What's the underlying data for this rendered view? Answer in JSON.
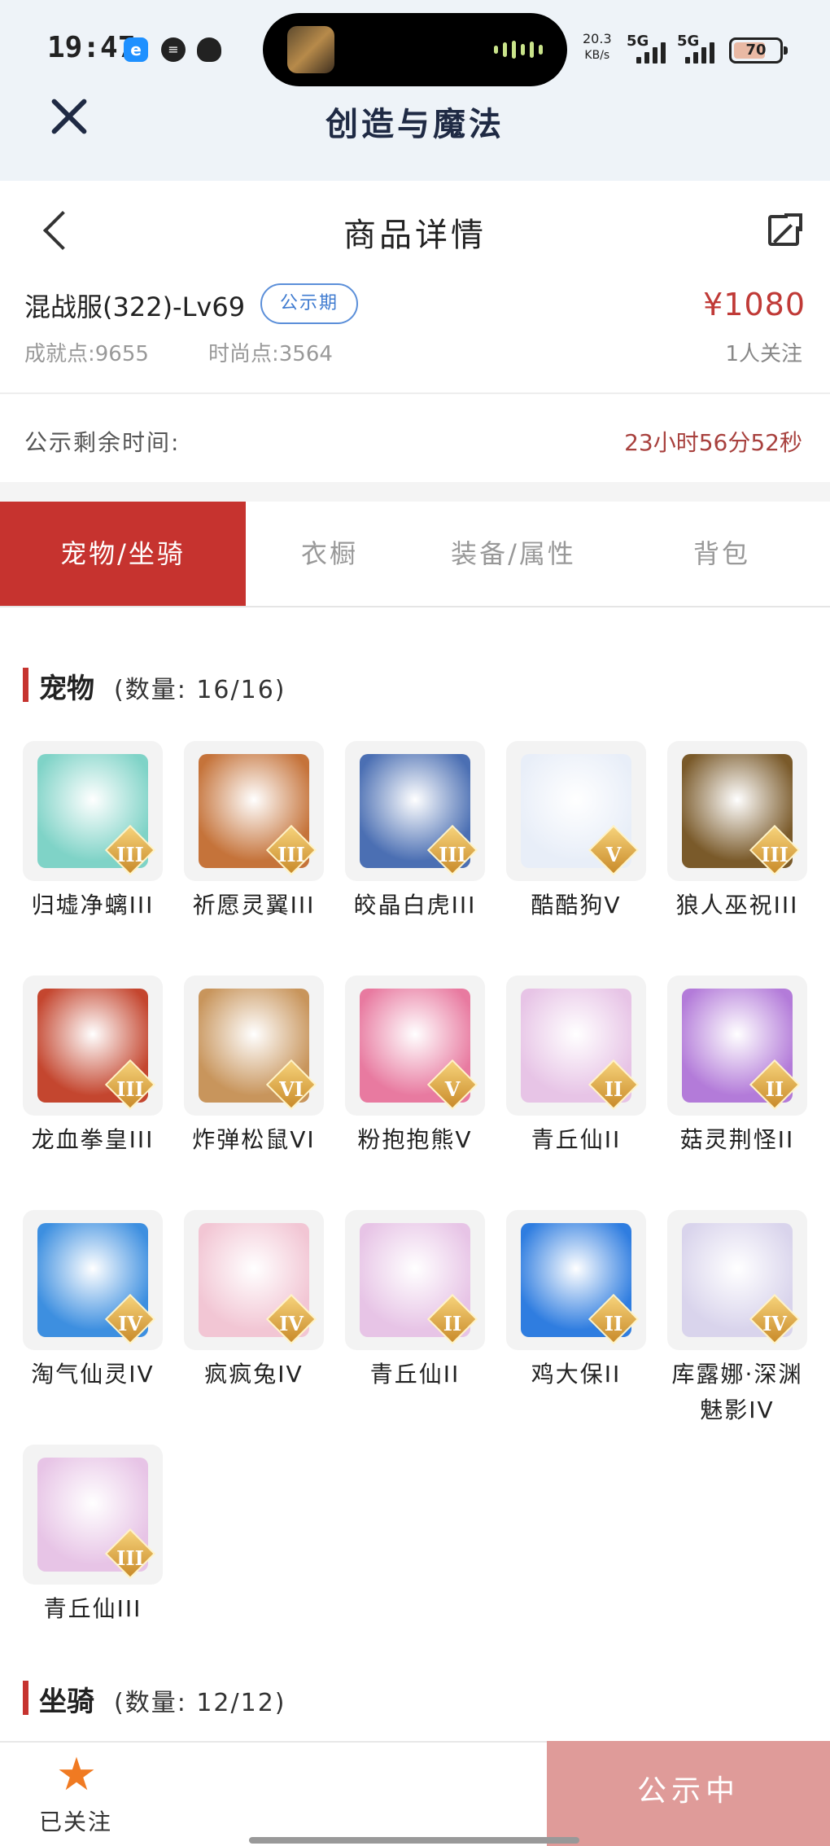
{
  "status_bar": {
    "time": "19:47",
    "net_speed_value": "20.3",
    "net_speed_unit": "KB/s",
    "sim1": "5G",
    "sim2": "5G",
    "battery": "70"
  },
  "app": {
    "title": "创造与魔法"
  },
  "page": {
    "title": "商品详情"
  },
  "listing": {
    "server": "混战服(322)-Lv69",
    "badge": "公示期",
    "price": "¥1080",
    "achievement": "成就点:9655",
    "fashion": "时尚点:3564",
    "followers": "1人关注",
    "remaining_label": "公示剩余时间:",
    "remaining_value": "23小时56分52秒"
  },
  "tabs": [
    {
      "label": "宠物/坐骑",
      "active": true
    },
    {
      "label": "衣橱",
      "active": false
    },
    {
      "label": "装备/属性",
      "active": false
    },
    {
      "label": "背包",
      "active": false
    }
  ],
  "pets_section": {
    "title": "宠物",
    "count": "(数量: 16/16)"
  },
  "mounts_section": {
    "title": "坐骑",
    "count": "(数量: 12/12)"
  },
  "pets": [
    {
      "name": "归墟净螭III",
      "tier": "III",
      "icon": "dragon-pet-icon",
      "color": "#7fd3c7"
    },
    {
      "name": "祈愿灵翼III",
      "tier": "III",
      "icon": "griffin-pet-icon",
      "color": "#c5733a"
    },
    {
      "name": "皎晶白虎III",
      "tier": "III",
      "icon": "white-tiger-pet-icon",
      "color": "#4b6fb3"
    },
    {
      "name": "酷酷狗V",
      "tier": "V",
      "icon": "cool-dog-pet-icon",
      "color": "#e8eef8"
    },
    {
      "name": "狼人巫祝III",
      "tier": "III",
      "icon": "werewolf-shaman-pet-icon",
      "color": "#7a5a2a"
    },
    {
      "name": "龙血拳皇III",
      "tier": "III",
      "icon": "dragon-blood-pet-icon",
      "color": "#c4462f"
    },
    {
      "name": "炸弹松鼠VI",
      "tier": "VI",
      "icon": "bomb-squirrel-pet-icon",
      "color": "#c8955c"
    },
    {
      "name": "粉抱抱熊V",
      "tier": "V",
      "icon": "pink-bear-pet-icon",
      "color": "#e87aa0"
    },
    {
      "name": "青丘仙II",
      "tier": "II",
      "icon": "fox-fairy-pet-icon",
      "color": "#e7c4e6"
    },
    {
      "name": "菇灵荆怪II",
      "tier": "II",
      "icon": "mushroom-sprite-pet-icon",
      "color": "#b37bd9"
    },
    {
      "name": "淘气仙灵IV",
      "tier": "IV",
      "icon": "naughty-sprite-pet-icon",
      "color": "#3d8fe0"
    },
    {
      "name": "疯疯兔IV",
      "tier": "IV",
      "icon": "crazy-rabbit-pet-icon",
      "color": "#f2c6d4"
    },
    {
      "name": "青丘仙II",
      "tier": "II",
      "icon": "fox-fairy-pet-icon",
      "color": "#e7c4e6"
    },
    {
      "name": "鸡大保II",
      "tier": "II",
      "icon": "chicken-pet-icon",
      "color": "#2f7de0"
    },
    {
      "name": "库露娜·深渊魅影IV",
      "tier": "IV",
      "icon": "kuluna-pet-icon",
      "color": "#d9d4ec"
    },
    {
      "name": "青丘仙III",
      "tier": "III",
      "icon": "fox-fairy-pet-icon",
      "color": "#e7c4e6"
    }
  ],
  "bottom_bar": {
    "follow_label": "已关注",
    "status_button": "公示中"
  },
  "colors": {
    "accent": "#c6332f",
    "price": "#c03a37",
    "badge": "#3f7bd0",
    "status_button": "#df9b99",
    "star": "#f07a22"
  }
}
